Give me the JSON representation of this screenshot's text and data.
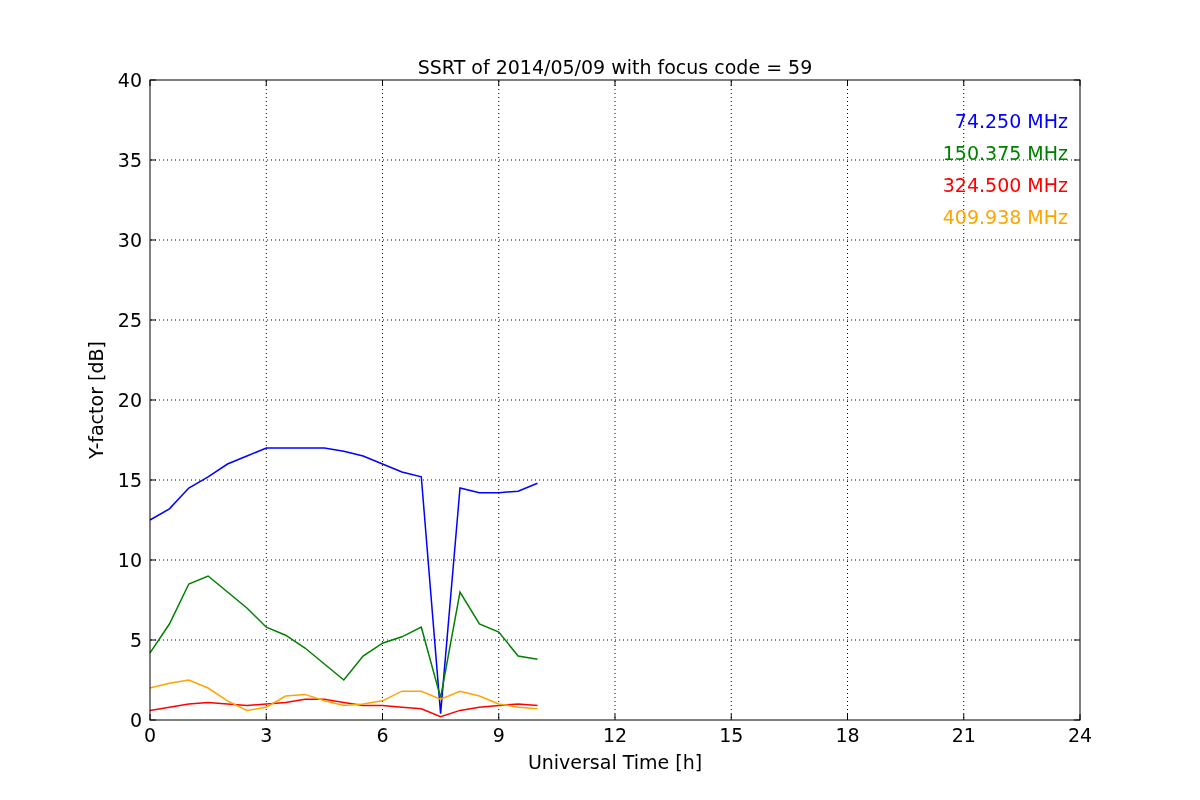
{
  "chart_data": {
    "type": "line",
    "title": "SSRT of 2014/05/09 with focus code = 59",
    "xlabel": "Universal Time [h]",
    "ylabel": "Y-factor [dB]",
    "x": [
      0,
      0.5,
      1,
      1.5,
      2,
      2.5,
      3,
      3.5,
      4,
      4.5,
      5,
      5.5,
      6,
      6.5,
      7,
      7.5,
      8,
      8.5,
      9,
      9.5,
      10
    ],
    "series": [
      {
        "name": "74.250 MHz",
        "color": "#0000ff",
        "values": [
          12.5,
          13.2,
          14.5,
          15.2,
          16,
          16.5,
          17,
          17,
          17,
          17,
          16.8,
          16.5,
          16,
          15.5,
          15.2,
          0.4,
          14.5,
          14.2,
          14.2,
          14.3,
          14.8
        ]
      },
      {
        "name": "150.375 MHz",
        "color": "#008000",
        "values": [
          4.2,
          6,
          8.5,
          9,
          8,
          7,
          5.8,
          5.3,
          4.5,
          3.5,
          2.5,
          4,
          4.8,
          5.2,
          5.8,
          1.4,
          8,
          6,
          5.5,
          4,
          3.8
        ]
      },
      {
        "name": "324.500 MHz",
        "color": "#ff0000",
        "values": [
          0.6,
          0.8,
          1,
          1.1,
          1,
          0.9,
          1,
          1.1,
          1.3,
          1.3,
          1.1,
          0.9,
          0.9,
          0.8,
          0.7,
          0.2,
          0.6,
          0.8,
          0.9,
          1,
          0.9
        ]
      },
      {
        "name": "409.938 MHz",
        "color": "#ffa500",
        "values": [
          2,
          2.3,
          2.5,
          2,
          1.2,
          0.6,
          0.8,
          1.5,
          1.6,
          1.2,
          0.9,
          1,
          1.2,
          1.8,
          1.8,
          1.3,
          1.8,
          1.5,
          1,
          0.8,
          0.7
        ]
      }
    ],
    "grid": true,
    "xlim": [
      0,
      24
    ],
    "ylim": [
      0,
      40
    ],
    "xticks": [
      0,
      3,
      6,
      9,
      12,
      15,
      18,
      21,
      24
    ],
    "yticks": [
      0,
      5,
      10,
      15,
      20,
      25,
      30,
      35,
      40
    ]
  }
}
